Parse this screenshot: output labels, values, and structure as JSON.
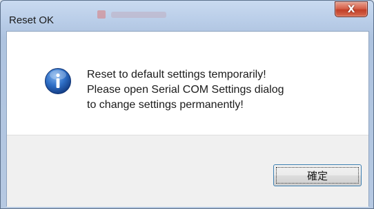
{
  "window": {
    "title": "Reset OK",
    "close_label": "X"
  },
  "dialog": {
    "icon": "info-icon",
    "message_lines": [
      "Reset to default settings temporarily!",
      "Please open Serial COM Settings dialog",
      "to change settings permanently!"
    ],
    "ok_label": "確定"
  },
  "colors": {
    "accent": "#3c7fb1",
    "icon_blue": "#1c5fb8",
    "close_red": "#c13f28"
  }
}
